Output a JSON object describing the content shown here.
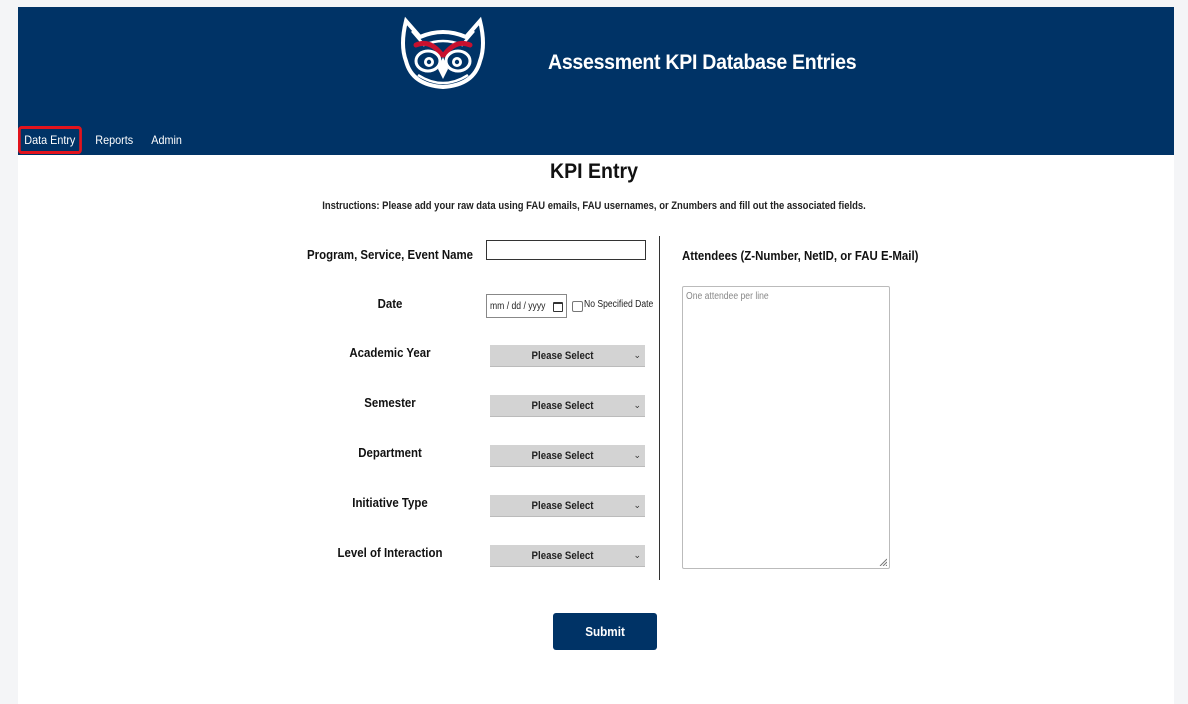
{
  "header": {
    "title": "Assessment KPI Database Entries",
    "logo_icon": "owl-logo-icon",
    "background": "#003366",
    "accent": "#c8102e"
  },
  "nav": {
    "items": [
      {
        "label": "Data Entry",
        "active": true
      },
      {
        "label": "Reports",
        "active": false
      },
      {
        "label": "Admin",
        "active": false
      }
    ],
    "highlight_color": "#e2141d"
  },
  "form": {
    "title": "KPI Entry",
    "instructions": "Instructions: Please add your raw data using FAU emails, FAU usernames, or Znumbers and fill out the associated fields.",
    "fields": {
      "program_label": "Program, Service, Event Name",
      "program_value": "",
      "date_label": "Date",
      "date_placeholder": "mm / dd / yyyy",
      "no_date_label": "No Specified Date",
      "academic_year_label": "Academic Year",
      "academic_year_value": "Please Select",
      "semester_label": "Semester",
      "semester_value": "Please Select",
      "department_label": "Department",
      "department_value": "Please Select",
      "initiative_label": "Initiative Type",
      "initiative_value": "Please Select",
      "interaction_label": "Level of Interaction",
      "interaction_value": "Please Select"
    },
    "attendees": {
      "label": "Attendees (Z-Number, NetID, or FAU E-Mail)",
      "placeholder": "One attendee per line"
    },
    "submit_label": "Submit"
  }
}
